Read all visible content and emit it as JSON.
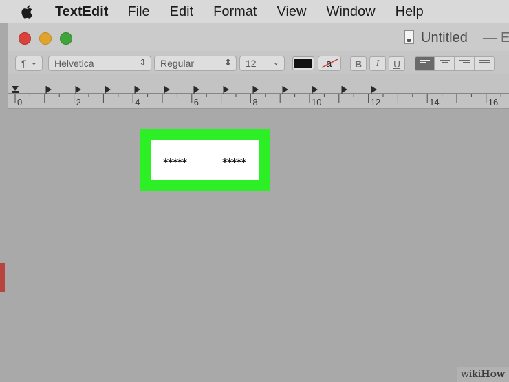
{
  "menubar": {
    "app_name": "TextEdit",
    "items": [
      "File",
      "Edit",
      "Format",
      "View",
      "Window",
      "Help"
    ]
  },
  "window": {
    "title": "Untitled",
    "dash": "—",
    "edited": "Ed"
  },
  "toolbar": {
    "paragraph_symbol": "¶",
    "font_family": "Helvetica",
    "font_style": "Regular",
    "font_size": "12",
    "text_color": "#111111",
    "highlight_letter": "a",
    "bold_label": "B",
    "italic_label": "I",
    "underline_label": "U",
    "alignment_active": "left"
  },
  "ruler": {
    "labels": [
      "0",
      "2",
      "4",
      "6",
      "8",
      "10",
      "12",
      "14",
      "16"
    ]
  },
  "document": {
    "left_text": "*****",
    "right_text": "*****",
    "highlight_color": "#2cef26"
  },
  "watermark": {
    "part1": "wiki",
    "part2": "How"
  }
}
